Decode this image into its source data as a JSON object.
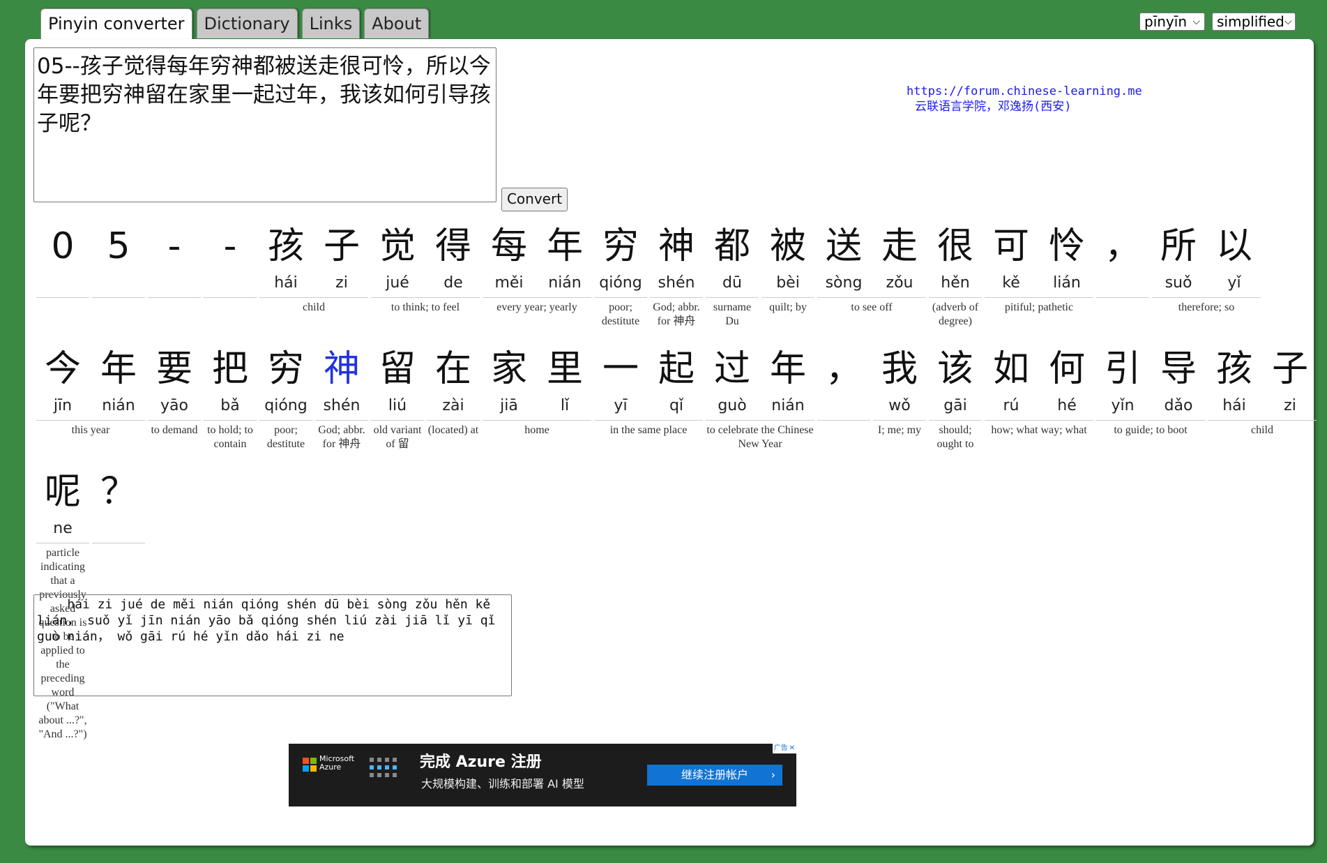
{
  "tabs": [
    {
      "label": "Pinyin converter",
      "active": true
    },
    {
      "label": "Dictionary",
      "active": false
    },
    {
      "label": "Links",
      "active": false
    },
    {
      "label": "About",
      "active": false
    }
  ],
  "selects": {
    "tone": "pīnyīn",
    "script": "simplified"
  },
  "input": {
    "text": "05--孩子觉得每年穷神都被送走很可怜，所以今年要把穷神留在家里一起过年，我该如何引导孩子呢？"
  },
  "convert_label": "Convert",
  "forum": {
    "url": "https://forum.chinese-learning.me",
    "name": "云联语言学院，邓逸扬(西安)"
  },
  "rows": [
    [
      {
        "chars": [
          "0"
        ],
        "pinyin": [
          ""
        ],
        "def": ""
      },
      {
        "chars": [
          "5"
        ],
        "pinyin": [
          ""
        ],
        "def": ""
      },
      {
        "chars": [
          "-"
        ],
        "pinyin": [
          ""
        ],
        "def": ""
      },
      {
        "chars": [
          "-"
        ],
        "pinyin": [
          ""
        ],
        "def": ""
      },
      {
        "chars": [
          "孩",
          "子"
        ],
        "pinyin": [
          "hái",
          "zi"
        ],
        "def": "child"
      },
      {
        "chars": [
          "觉",
          "得"
        ],
        "pinyin": [
          "jué",
          "de"
        ],
        "def": "to think; to feel"
      },
      {
        "chars": [
          "每",
          "年"
        ],
        "pinyin": [
          "měi",
          "nián"
        ],
        "def": "every year; yearly"
      },
      {
        "chars": [
          "穷"
        ],
        "pinyin": [
          "qióng"
        ],
        "def": "poor; destitute"
      },
      {
        "chars": [
          "神"
        ],
        "pinyin": [
          "shén"
        ],
        "def": "God; abbr. for 神舟"
      },
      {
        "chars": [
          "都"
        ],
        "pinyin": [
          "dū"
        ],
        "def": "surname Du"
      },
      {
        "chars": [
          "被"
        ],
        "pinyin": [
          "bèi"
        ],
        "def": "quilt; by"
      },
      {
        "chars": [
          "送",
          "走"
        ],
        "pinyin": [
          "sòng",
          "zǒu"
        ],
        "def": "to see off"
      },
      {
        "chars": [
          "很"
        ],
        "pinyin": [
          "hěn"
        ],
        "def": "(adverb of degree)"
      },
      {
        "chars": [
          "可",
          "怜"
        ],
        "pinyin": [
          "kě",
          "lián"
        ],
        "def": "pitiful; pathetic"
      },
      {
        "chars": [
          "，"
        ],
        "pinyin": [
          ""
        ],
        "def": ""
      },
      {
        "chars": [
          "所",
          "以"
        ],
        "pinyin": [
          "suǒ",
          "yǐ"
        ],
        "def": "therefore; so"
      }
    ],
    [
      {
        "chars": [
          "今",
          "年"
        ],
        "pinyin": [
          "jīn",
          "nián"
        ],
        "def": "this year"
      },
      {
        "chars": [
          "要"
        ],
        "pinyin": [
          "yāo"
        ],
        "def": "to demand"
      },
      {
        "chars": [
          "把"
        ],
        "pinyin": [
          "bǎ"
        ],
        "def": "to hold; to contain"
      },
      {
        "chars": [
          "穷"
        ],
        "pinyin": [
          "qióng"
        ],
        "def": "poor; destitute"
      },
      {
        "chars": [
          "神"
        ],
        "pinyin": [
          "shén"
        ],
        "def": "God; abbr. for 神舟",
        "highlight": true
      },
      {
        "chars": [
          "留"
        ],
        "pinyin": [
          "liú"
        ],
        "def": "old variant of 留"
      },
      {
        "chars": [
          "在"
        ],
        "pinyin": [
          "zài"
        ],
        "def": "(located) at"
      },
      {
        "chars": [
          "家",
          "里"
        ],
        "pinyin": [
          "jiā",
          "lǐ"
        ],
        "def": "home"
      },
      {
        "chars": [
          "一",
          "起"
        ],
        "pinyin": [
          "yī",
          "qǐ"
        ],
        "def": "in the same place"
      },
      {
        "chars": [
          "过",
          "年"
        ],
        "pinyin": [
          "guò",
          "nián"
        ],
        "def": "to celebrate the Chinese New Year"
      },
      {
        "chars": [
          "，"
        ],
        "pinyin": [
          ""
        ],
        "def": ""
      },
      {
        "chars": [
          "我"
        ],
        "pinyin": [
          "wǒ"
        ],
        "def": "I; me; my"
      },
      {
        "chars": [
          "该"
        ],
        "pinyin": [
          "gāi"
        ],
        "def": "should; ought to"
      },
      {
        "chars": [
          "如",
          "何"
        ],
        "pinyin": [
          "rú",
          "hé"
        ],
        "def": "how; what way; what"
      },
      {
        "chars": [
          "引",
          "导"
        ],
        "pinyin": [
          "yǐn",
          "dǎo"
        ],
        "def": "to guide; to boot"
      },
      {
        "chars": [
          "孩",
          "子"
        ],
        "pinyin": [
          "hái",
          "zi"
        ],
        "def": "child"
      }
    ],
    [
      {
        "chars": [
          "呢"
        ],
        "pinyin": [
          "ne"
        ],
        "def": "particle indicating that a previously asked question is to be applied to the preceding word (\"What about ...?\", \"And ...?\")"
      },
      {
        "chars": [
          "？"
        ],
        "pinyin": [
          ""
        ],
        "def": ""
      }
    ]
  ],
  "output": {
    "text": "    hái zi jué de měi nián qióng shén dū bèi sòng zǒu hěn kě lián， suǒ yǐ jīn nián yāo bǎ qióng shén liú zài jiā lǐ yī qǐ guò nián， wǒ gāi rú hé yǐn dǎo hái zi ne"
  },
  "ad": {
    "brand_line1": "Microsoft",
    "brand_line2": "Azure",
    "headline": "完成 Azure 注册",
    "subline": "大规模构建、训练和部署 AI 模型",
    "button": "继续注册帐户",
    "button_arrow": "›",
    "tag": "广告",
    "close": "✕",
    "ms_colors": [
      "#f25022",
      "#7fba00",
      "#00a4ef",
      "#ffb900"
    ]
  }
}
